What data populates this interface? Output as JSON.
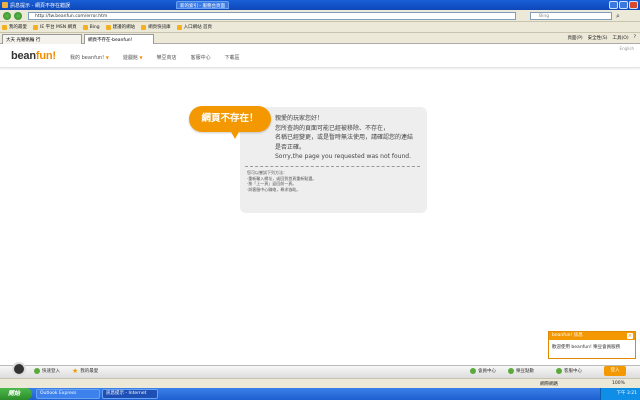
{
  "browser": {
    "window_title": "訊息提示 - 網頁不存在錯誤",
    "other_window_title": "新的索引 - 服務台頁面",
    "address": "http://tw.beanfun.com/error.htm",
    "search_placeholder": "Bing",
    "favorites": [
      {
        "label": "我的最愛"
      },
      {
        "label": "IE 平台 MSN 網頁"
      },
      {
        "label": "Bing"
      },
      {
        "label": "建議的網站"
      },
      {
        "label": "網頁快訊庫"
      },
      {
        "label": "入口網站 首頁"
      }
    ],
    "tabs": [
      {
        "label": "大天 光鸞帆輪 行"
      },
      {
        "label": "網頁不存在-beanfun!"
      }
    ],
    "tools": [
      "頁面(P)",
      "安全性(S)",
      "工具(O)",
      "?"
    ]
  },
  "site": {
    "logo_main": "bean",
    "logo_accent": "fun!",
    "nav": [
      {
        "label": "我的 beanfun!"
      },
      {
        "label": "遊戲館"
      },
      {
        "label": "樂豆商店"
      },
      {
        "label": "客服中心"
      },
      {
        "label": "下載區"
      }
    ],
    "top_right": "English"
  },
  "error": {
    "badge": "網頁不存在！",
    "lines": [
      "親愛的玩家您好！",
      "您所查詢的頁面可能已經被移除、不存在，",
      "名稱已經變更，或是暫時無法使用，請確認您的連結",
      "是否正確。",
      "Sorry,the page you requested was not found."
    ],
    "hints": [
      "您可以嘗試下列方法：",
      "‧重新輸入網址，或回到首頁重新點選。",
      "‧按「上一頁」返回前一頁。",
      "‧與客服中心聯絡，尋求協助。"
    ]
  },
  "popup": {
    "title": "beanfun! 訊息",
    "body": "歡迎使用 beanfun! 樂豆會員服務"
  },
  "pagebar": {
    "items": [
      "快速登入",
      "我的最愛"
    ],
    "right_items": [
      "會員中心",
      "樂豆點數",
      "客服中心"
    ],
    "login_label": "登入"
  },
  "statusbar": {
    "zone": "網際網路",
    "zoom": "100%"
  },
  "taskbar": {
    "start_label": "開始",
    "tasks": [
      {
        "label": "Outlook Express"
      },
      {
        "label": "訊息提示 - Internet"
      }
    ],
    "clock": "下午 3:21"
  }
}
